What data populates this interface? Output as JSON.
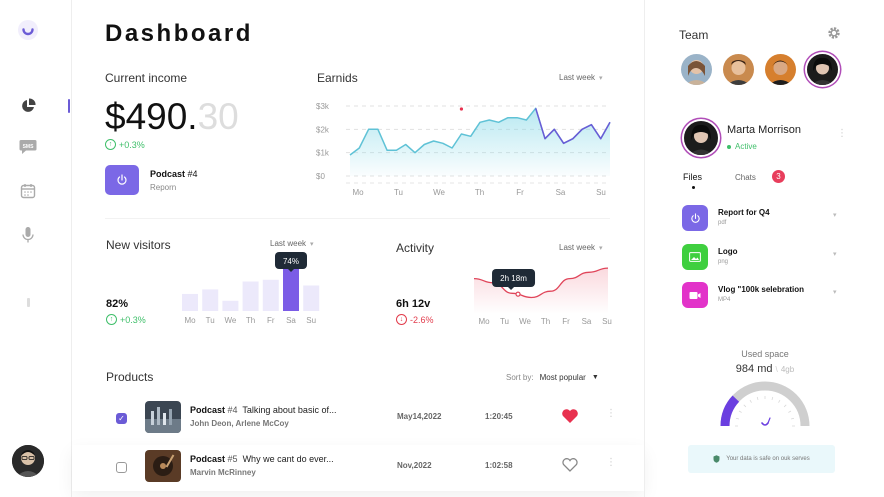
{
  "nav": {
    "items": [
      "chart-icon",
      "sms-icon",
      "calendar-icon",
      "mic-icon"
    ],
    "accent": "#6b5bd6"
  },
  "dashboard": {
    "title": "Dashboard"
  },
  "income": {
    "label": "Current income",
    "value_main": "$490.",
    "value_cents": "30",
    "change": "+0.3%",
    "podcast_title": "Podcast",
    "podcast_num": "#4",
    "podcast_sub": "Reporn"
  },
  "earnings": {
    "label": "Earnids",
    "period": "Last  week"
  },
  "visitors": {
    "label": "New visitors",
    "period": "Last  week",
    "value": "82%",
    "change": "+0.3%",
    "tooltip": "74%"
  },
  "activity": {
    "label": "Activity",
    "period": "Last  week",
    "value": "6h 12v",
    "change": "-2.6%",
    "tooltip": "2h 18m"
  },
  "products": {
    "label": "Products",
    "sort_label": "Sort by:",
    "sort_value": "Most popular",
    "rows": [
      {
        "title": "Podcast",
        "num": "#4",
        "desc": "Talking about basic of...",
        "authors": "John Deon, Arlene McCoy",
        "date": "May14,2022",
        "duration": "1:20:45",
        "liked": true,
        "checked": true
      },
      {
        "title": "Podcast",
        "num": "#5",
        "desc": "Why we cant do ever...",
        "authors": "Marvin McRinney",
        "date": "Nov,2022",
        "duration": "1:02:58",
        "liked": false,
        "checked": false
      }
    ]
  },
  "team": {
    "label": "Team",
    "profile": {
      "name": "Marta Morrison",
      "status": "Active"
    },
    "tabs": {
      "files": "Files",
      "chats": "Chats",
      "chats_badge": "3"
    },
    "files": [
      {
        "name": "Report for Q4",
        "type": "pdf",
        "color": "#7b68e6",
        "icon": "power-icon"
      },
      {
        "name": "Logo",
        "type": "png",
        "color": "#3fcf3f",
        "icon": "image-icon"
      },
      {
        "name": "Vlog \"100k selebration",
        "type": "MP4",
        "color": "#e233c9",
        "icon": "video-icon"
      }
    ],
    "used_space": {
      "label": "Used space",
      "value": "984 md",
      "total": "4gb",
      "fraction": 0.24
    },
    "safe_note": "Your data is safe on ouk serves"
  },
  "chart_data": [
    {
      "type": "line",
      "title": "Earnids",
      "x": [
        "Mo",
        "Tu",
        "We",
        "Th",
        "Fr",
        "Sa",
        "Su"
      ],
      "y_ticks": [
        "$0",
        "$1k",
        "$2k",
        "$3k"
      ],
      "ylim": [
        0,
        3000
      ],
      "series": [
        {
          "name": "",
          "color": "#5fc2d6",
          "values": [
            900,
            1200,
            2000,
            2000,
            1100,
            1100,
            1350,
            1000,
            1350,
            1500,
            1400,
            1200,
            1800,
            1700,
            2300,
            2400,
            2300,
            2500,
            2500,
            2400,
            2900,
            1600,
            2000,
            1400,
            1600,
            2000,
            2200,
            1600,
            2300
          ]
        },
        {
          "name": "",
          "color": "#6b5bd6",
          "values": [
            null,
            null,
            null,
            null,
            null,
            null,
            null,
            null,
            null,
            null,
            null,
            null,
            null,
            null,
            null,
            null,
            null,
            null,
            null,
            null,
            2900,
            1600,
            2000,
            1400,
            1600,
            2000,
            2200,
            1600,
            2300
          ]
        }
      ]
    },
    {
      "type": "bar",
      "title": "New visitors",
      "categories": [
        "Mo",
        "Tu",
        "We",
        "Th",
        "Fr",
        "Sa",
        "Su"
      ],
      "values": [
        30,
        38,
        18,
        52,
        55,
        74,
        45
      ],
      "highlight": "Sa",
      "colors": {
        "normal": "#ece9fb",
        "highlight": "#7b5ce6"
      }
    },
    {
      "type": "line",
      "title": "Activity",
      "x": [
        "Mo",
        "Tu",
        "We",
        "Th",
        "Fr",
        "Sa",
        "Su"
      ],
      "series": [
        {
          "name": "",
          "color": "#e0455a",
          "values": [
            70,
            60,
            35,
            25,
            40,
            70,
            85,
            95
          ]
        }
      ]
    }
  ]
}
